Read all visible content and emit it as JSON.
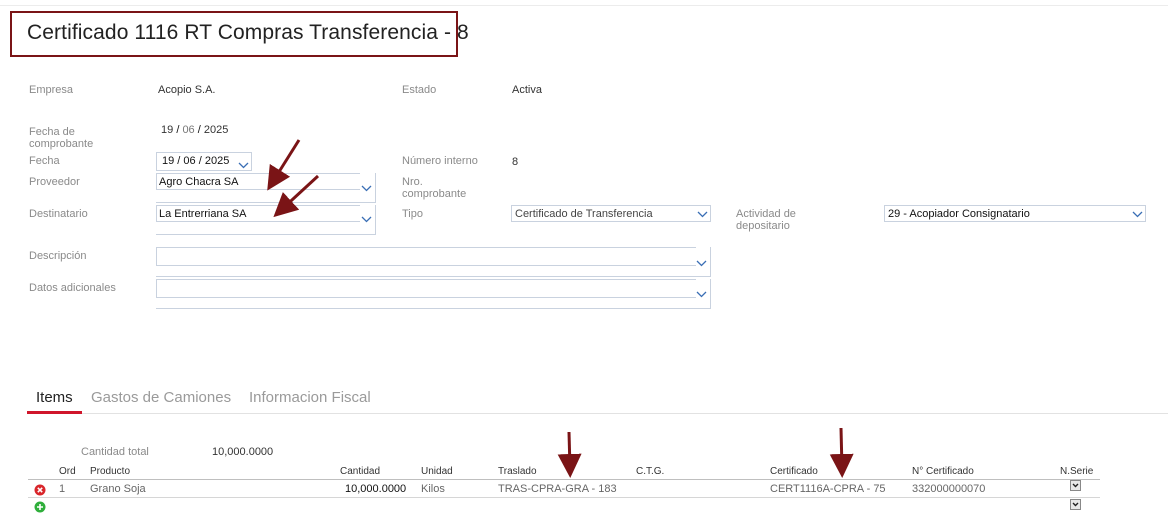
{
  "page": {
    "title": "Certificado 1116 RT Compras Transferencia - 8"
  },
  "form": {
    "empresa_label": "Empresa",
    "empresa_value": "Acopio S.A.",
    "estado_label": "Estado",
    "estado_value": "Activa",
    "fecha_comprobante_label": "Fecha de comprobante",
    "fecha_comprobante_day": "19",
    "fecha_comprobante_month": "06",
    "fecha_comprobante_year": "2025",
    "fecha_label": "Fecha",
    "fecha_day": "19",
    "fecha_month": "06",
    "fecha_year": "2025",
    "numero_interno_label": "Número interno",
    "numero_interno_value": "8",
    "proveedor_label": "Proveedor",
    "proveedor_value": "Agro Chacra SA",
    "nro_comprobante_label": "Nro. comprobante",
    "destinatario_label": "Destinatario",
    "destinatario_value": "La Entrerriana SA",
    "tipo_label": "Tipo",
    "tipo_value": "Certificado de Transferencia",
    "actividad_label": "Actividad de depositario",
    "actividad_value": "29 - Acopiador Consignatario",
    "descripcion_label": "Descripción",
    "descripcion_value": "",
    "datos_adicionales_label": "Datos adicionales",
    "datos_adicionales_value": ""
  },
  "tabs": [
    {
      "label": "Items",
      "active": true
    },
    {
      "label": "Gastos de Camiones",
      "active": false
    },
    {
      "label": "Informacion Fiscal",
      "active": false
    }
  ],
  "items": {
    "cantidad_total_label": "Cantidad total",
    "cantidad_total_value": "10,000.0000",
    "columns": [
      "Ord",
      "Producto",
      "Cantidad",
      "Unidad",
      "Traslado",
      "C.T.G.",
      "Certificado",
      "N° Certificado",
      "N.Serie"
    ],
    "rows": [
      {
        "ord": "1",
        "producto": "Grano Soja",
        "cantidad": "10,000.0000",
        "unidad": "Kilos",
        "traslado": "TRAS-CPRA-GRA - 183",
        "ctg": "",
        "certificado": "CERT1116A-CPRA - 75",
        "n_certificado": "332000000070"
      }
    ]
  },
  "colors": {
    "accent": "#d0162b",
    "annotation": "#7a1416",
    "field_border": "#c9d2df",
    "chevron": "#3a6fb5"
  },
  "icons": {
    "delete_row": "delete-icon",
    "add_row": "add-icon",
    "dropdown": "chevron-down-icon"
  }
}
